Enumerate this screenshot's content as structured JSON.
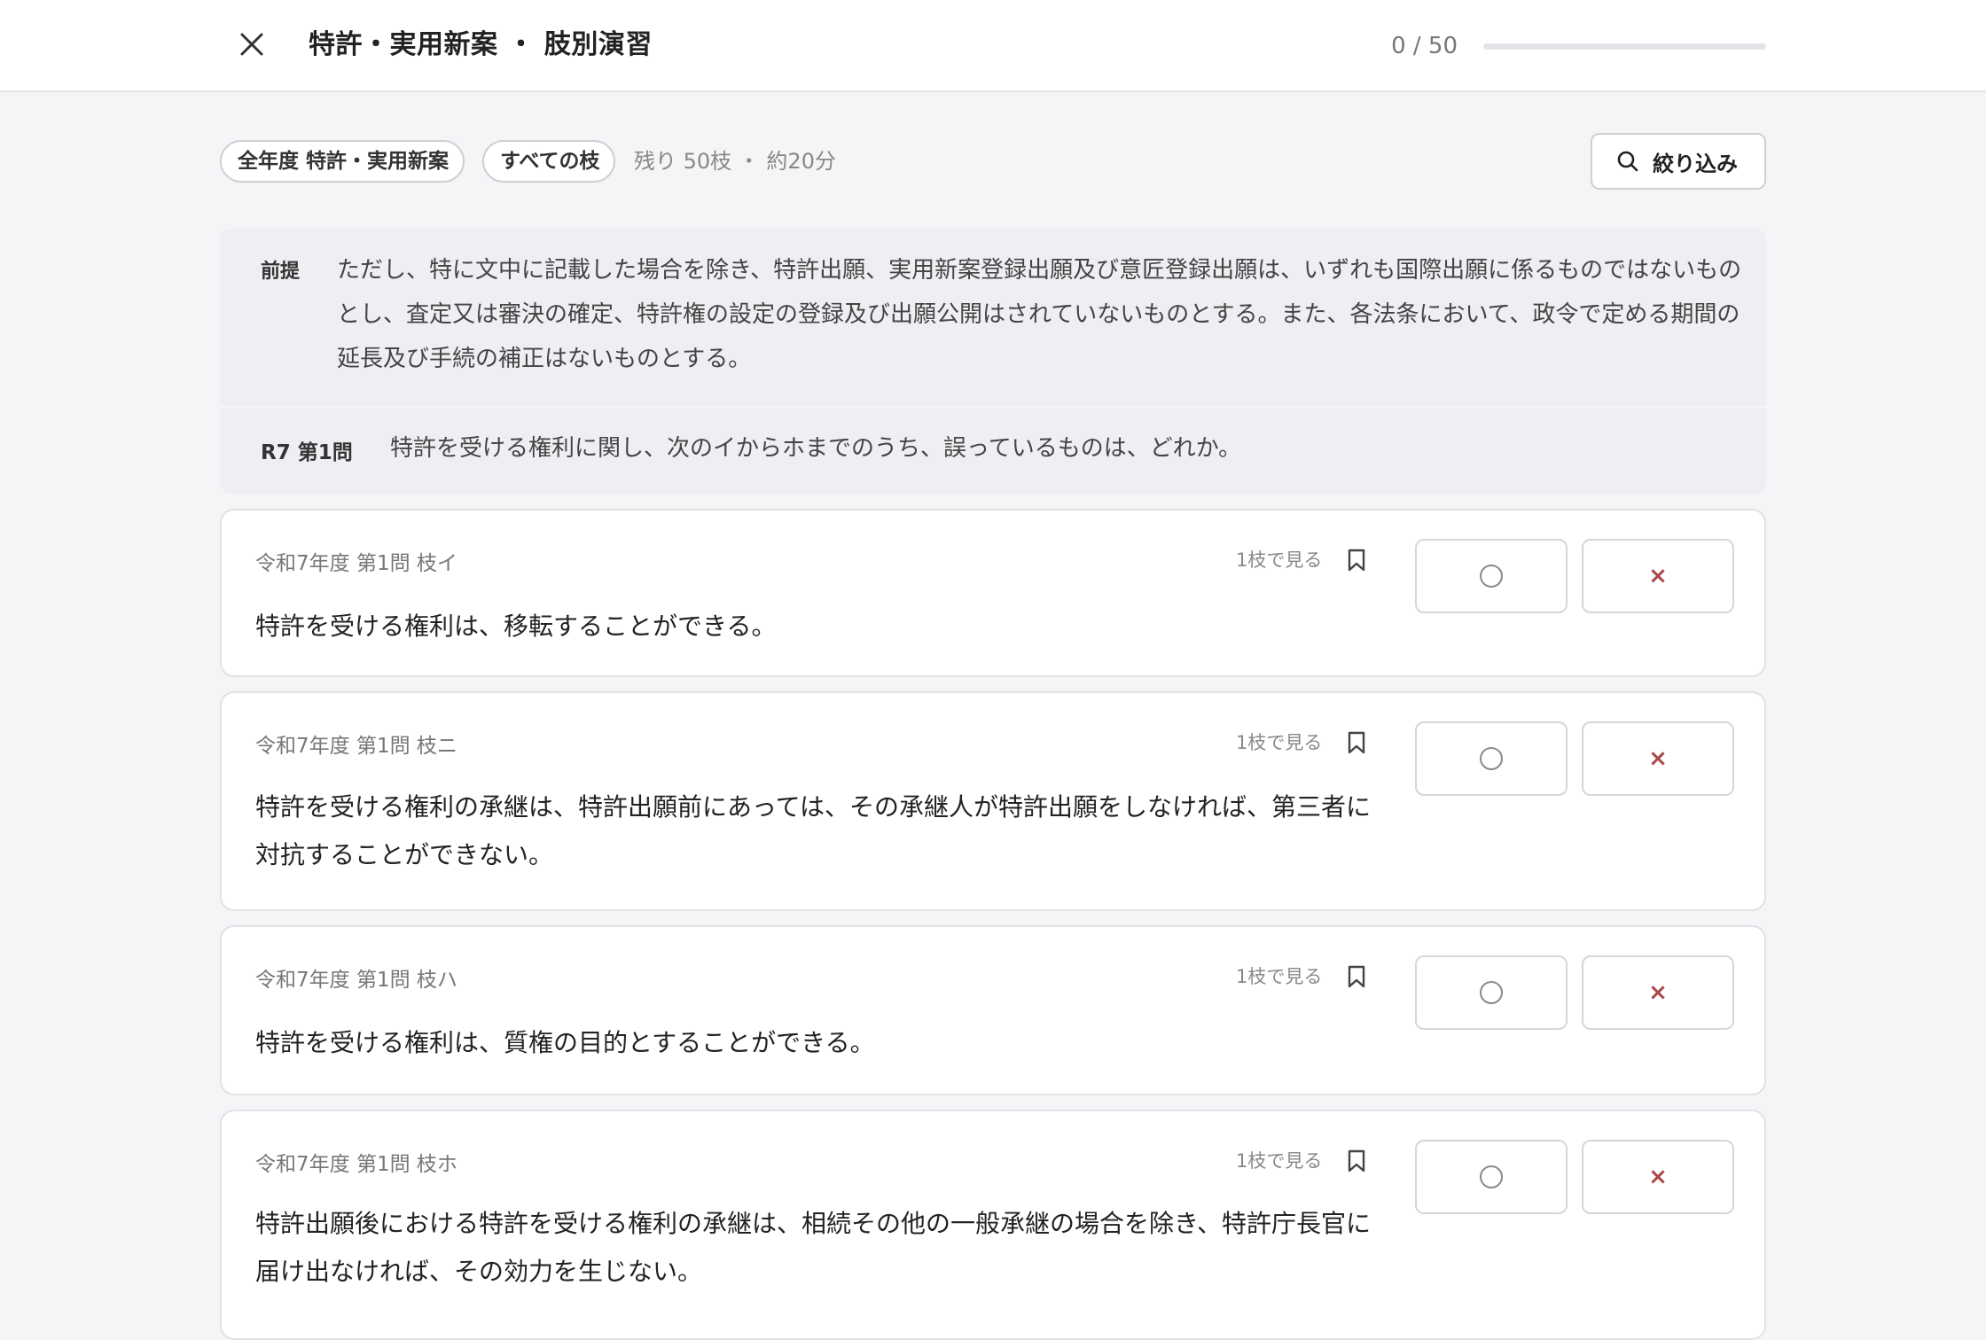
{
  "header": {
    "title": "特許・実用新案 ・ 肢別演習",
    "progress_text": "0 / 50",
    "progress_fraction": 0
  },
  "filters": {
    "year_chip": "全年度 特許・実用新案",
    "branch_chip": "すべての枝",
    "remaining": "残り 50枝 ・ 約20分",
    "filter_button": "絞り込み"
  },
  "premise": {
    "tag": "前提",
    "text": "ただし、特に文中に記載した場合を除き、特許出願、実用新案登録出願及び意匠登録出願は、いずれも国際出願に係るものではないものとし、査定又は審決の確定、特許権の設定の登録及び出願公開はされていないものとする。また、各法条において、政令で定める期間の延長及び手続の補正はないものとする。"
  },
  "question": {
    "tag": "R7 第1問",
    "text": "特許を受ける権利に関し、次のイからホまでのうち、誤っているものは、どれか。"
  },
  "cards": [
    {
      "meta": "令和7年度 第1問 枝イ",
      "view_one": "1枝で見る",
      "statement": "特許を受ける権利は、移転することができる。"
    },
    {
      "meta": "令和7年度 第1問 枝ニ",
      "view_one": "1枝で見る",
      "statement": "特許を受ける権利の承継は、特許出願前にあっては、その承継人が特許出願をしなければ、第三者に対抗することができない。"
    },
    {
      "meta": "令和7年度 第1問 枝ハ",
      "view_one": "1枝で見る",
      "statement": "特許を受ける権利は、質権の目的とすることができる。"
    },
    {
      "meta": "令和7年度 第1問 枝ホ",
      "view_one": "1枝で見る",
      "statement": "特許出願後における特許を受ける権利の承継は、相続その他の一般承継の場合を除き、特許庁長官に届け出なければ、その効力を生じない。"
    }
  ],
  "answer_marks": {
    "correct": "○",
    "incorrect": "×"
  },
  "colors": {
    "accent": "#2d7a5c",
    "incorrect_mark": "#a84848"
  },
  "icons": {
    "close": "close-icon",
    "search": "search-icon",
    "bookmark": "bookmark-icon"
  }
}
